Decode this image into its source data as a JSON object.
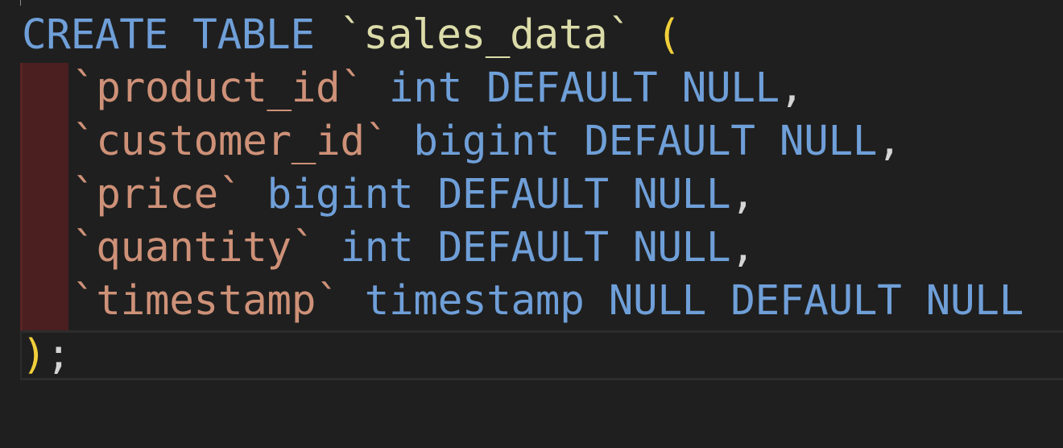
{
  "editor": {
    "language": "SQL",
    "line1": {
      "create": "CREATE",
      "table": "TABLE",
      "name": "`sales_data`",
      "open_paren": "("
    },
    "columns": [
      {
        "name": "`product_id`",
        "type": "int DEFAULT NULL",
        "sep": ","
      },
      {
        "name": "`customer_id`",
        "type": "bigint DEFAULT NULL",
        "sep": ","
      },
      {
        "name": "`price`",
        "type": "bigint DEFAULT NULL",
        "sep": ","
      },
      {
        "name": "`quantity`",
        "type": "int DEFAULT NULL",
        "sep": ","
      },
      {
        "name": "`timestamp`",
        "type": "timestamp NULL DEFAULT NULL",
        "sep": ""
      }
    ],
    "close": {
      "paren": ")",
      "semicolon": ";"
    }
  },
  "colors": {
    "background": "#1f1f1f",
    "keyword": "#6f9fd8",
    "table_name": "#dcdcaa",
    "column_name": "#ce9178",
    "bracket": "#f1cf3b",
    "punctuation": "#d4d4d4",
    "indent_highlight": "#4b1f20"
  }
}
